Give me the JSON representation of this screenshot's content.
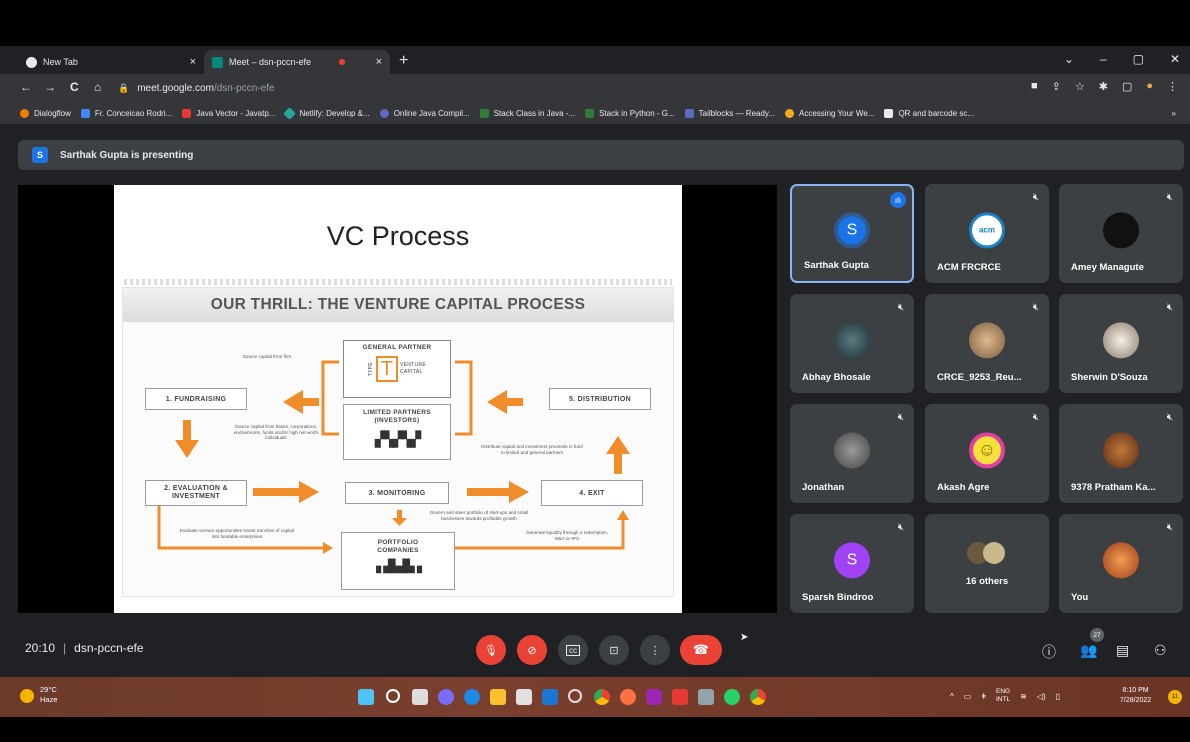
{
  "browser": {
    "tabs": [
      {
        "label": "New Tab",
        "close": "×"
      },
      {
        "label": "Meet – dsn-pccn-efe",
        "close": "×"
      }
    ],
    "new_tab": "+",
    "window_controls": [
      "⌄",
      "–",
      "▢",
      "✕"
    ],
    "nav": {
      "back": "←",
      "forward": "→",
      "reload": "C",
      "home": "⌂"
    },
    "address": {
      "domain": "meet.google.com",
      "path": "/dsn-pccn-efe"
    },
    "toolbar_icons": [
      "■",
      "⇪",
      "☆",
      "✱",
      "▢",
      "●",
      "⋮"
    ],
    "bookmarks": [
      "Dialogflow",
      "Fr. Conceicao Rodri...",
      "Java Vector - Javatp...",
      "Netlify: Develop &...",
      "Online Java Compil...",
      "Stack Class in Java -...",
      "Stack in Python - G...",
      "Tailblocks — Ready...",
      "Accessing Your We...",
      "QR and barcode sc..."
    ],
    "bookmarks_more": "»"
  },
  "meet": {
    "presenting": {
      "icon": "S",
      "text": "Sarthak Gupta is presenting"
    },
    "slide": {
      "title": "VC Process",
      "header": "OUR THRILL: THE VENTURE CAPITAL PROCESS",
      "general_partner": "GENERAL PARTNER",
      "logo_type": "TYPE",
      "logo_t": "T",
      "logo_venture": "VENTURE",
      "logo_capital": "CAPITAL",
      "limited_partners": "LIMITED PARTNERS (INVESTORS)",
      "fundraising": "1. FUNDRAISING",
      "distribution": "5. DISTRIBUTION",
      "evaluation": "2. EVALUATION & INVESTMENT",
      "monitoring": "3. MONITORING",
      "exit": "4. EXIT",
      "portfolio": "PORTFOLIO COMPANIES",
      "note_source_firm": "Source capital from firm",
      "note_source_banks": "Source capital from banks, corporations, endowments, funds and/or high net worth individuals",
      "note_distribute": "Distribute capital and investment proceeds in fund to limited and general partners",
      "note_govern": "Govern and steer portfolio of start-ups and small businesses towards profitable growth",
      "note_evaluate": "Evaluate venture opportunities Invest tranches of capital into fundable enterprises",
      "note_liquidity": "Generate liquidity through a redemption, M&A or IPO"
    },
    "participants": [
      {
        "name": "Sarthak Gupta",
        "initial": "S",
        "color": "#1a73e8",
        "speaking": true
      },
      {
        "name": "ACM FRCRCE",
        "initial": "acm",
        "color": "#1b82c4"
      },
      {
        "name": "Amey Managute",
        "initial": "",
        "color": "#222222"
      },
      {
        "name": "Abhay Bhosale",
        "initial": "",
        "color": "#2a4a52"
      },
      {
        "name": "CRCE_9253_Reu...",
        "initial": "",
        "color": "#c9a27a"
      },
      {
        "name": "Sherwin D'Souza",
        "initial": "",
        "color": "#e9e4dc"
      },
      {
        "name": "Jonathan",
        "initial": "",
        "color": "#5a5a5a"
      },
      {
        "name": "Akash Agre",
        "initial": "☺",
        "color": "#f4e13a"
      },
      {
        "name": "9378 Pratham Ka...",
        "initial": "",
        "color": "#8a4b2a"
      },
      {
        "name": "Sparsh Bindroo",
        "initial": "S",
        "color": "#a142f4"
      },
      {
        "name": "16 others",
        "initial": "",
        "color": "#8d8670"
      },
      {
        "name": "You",
        "initial": "",
        "color": "#c0522a"
      }
    ],
    "time": "20:10",
    "code": "dsn-pccn-efe",
    "separator": "|",
    "people_count": "27",
    "controls": {
      "mic": "🎙",
      "cam": "⊘",
      "cc": "cc",
      "present": "⊡",
      "more": "⋮",
      "hangup": "☎"
    },
    "right_icons": {
      "info": "ⓘ",
      "people": "👥",
      "chat": "▤",
      "activities": "⚇"
    }
  },
  "taskbar": {
    "temp": "29°C",
    "weather": "Haze",
    "lang1": "ENG",
    "lang2": "INTL",
    "time": "8:10 PM",
    "date": "7/28/2022",
    "notifications": "11"
  },
  "colors": {
    "meet_bg": "#202124",
    "tile_bg": "#3c4043",
    "red": "#ea4335",
    "arrow": "#f08c2a"
  }
}
